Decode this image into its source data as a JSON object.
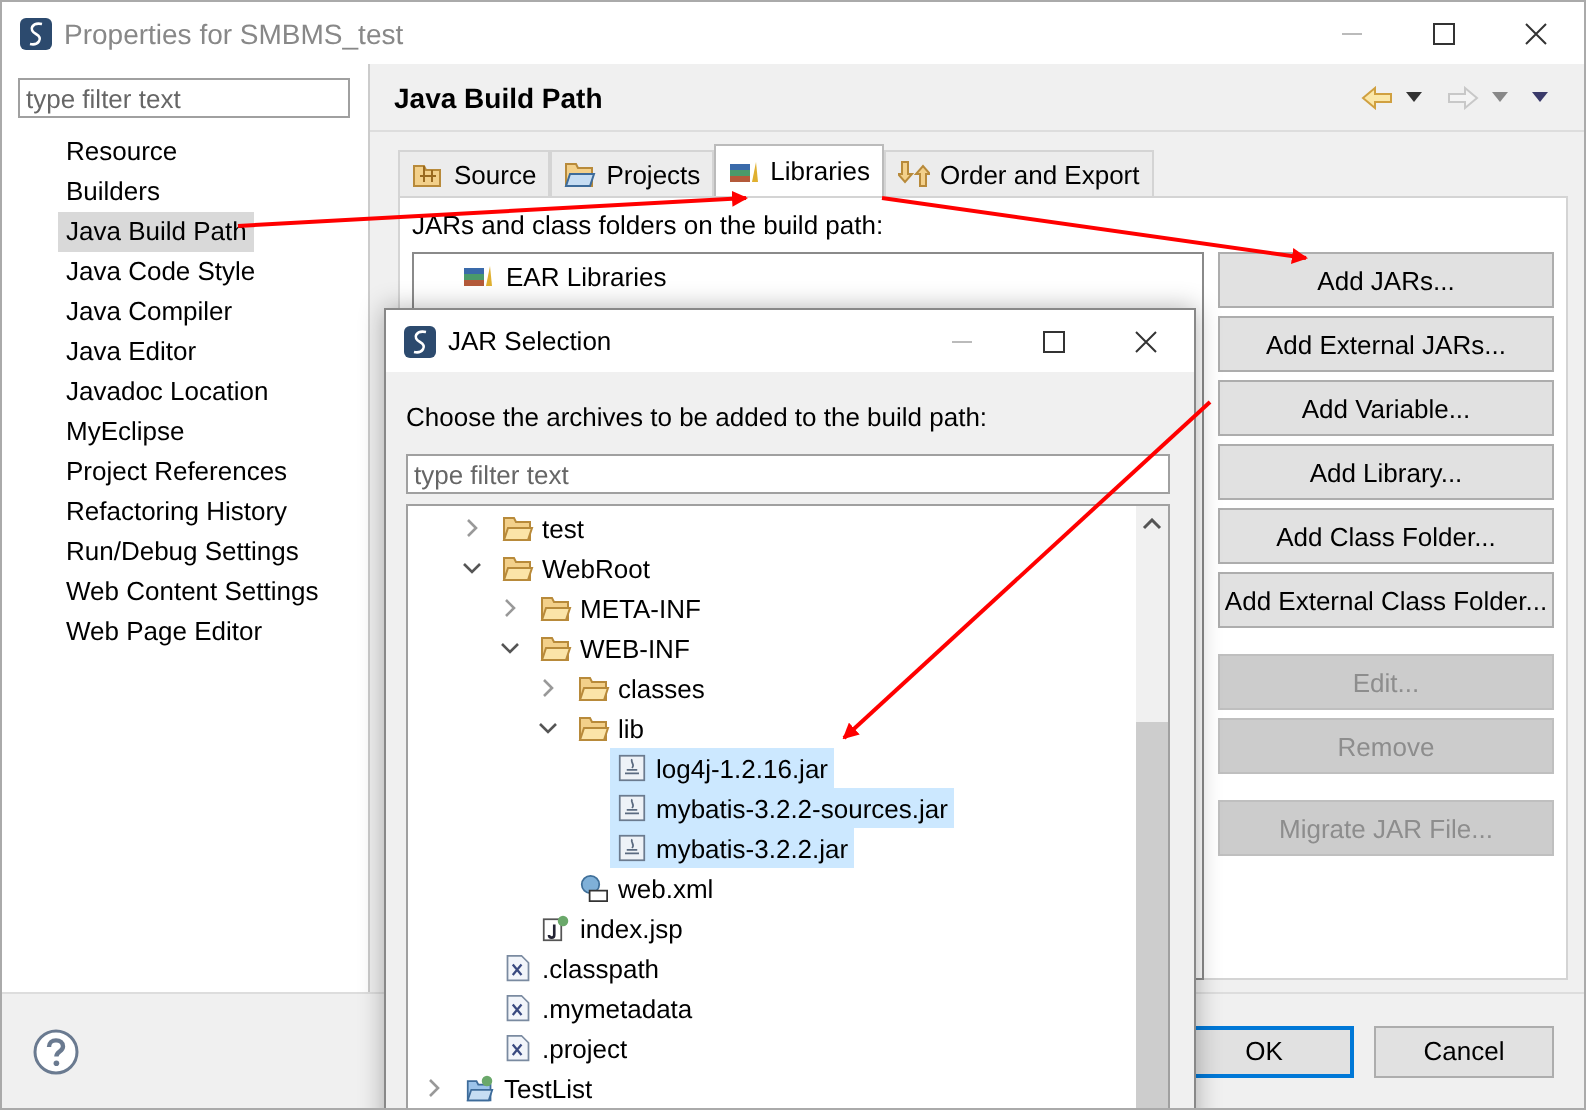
{
  "window": {
    "title": "Properties for SMBMS_test"
  },
  "sidebar": {
    "filter_placeholder": "type filter text",
    "items": [
      {
        "label": "Resource",
        "selected": false
      },
      {
        "label": "Builders",
        "selected": false
      },
      {
        "label": "Java Build Path",
        "selected": true
      },
      {
        "label": "Java Code Style",
        "selected": false
      },
      {
        "label": "Java Compiler",
        "selected": false
      },
      {
        "label": "Java Editor",
        "selected": false
      },
      {
        "label": "Javadoc Location",
        "selected": false
      },
      {
        "label": "MyEclipse",
        "selected": false
      },
      {
        "label": "Project References",
        "selected": false
      },
      {
        "label": "Refactoring History",
        "selected": false
      },
      {
        "label": "Run/Debug Settings",
        "selected": false
      },
      {
        "label": "Web Content Settings",
        "selected": false
      },
      {
        "label": "Web Page Editor",
        "selected": false
      }
    ]
  },
  "page": {
    "title": "Java Build Path",
    "tabs": [
      {
        "label": "Source",
        "kind": "source",
        "selected": false
      },
      {
        "label": "Projects",
        "kind": "projects",
        "selected": false
      },
      {
        "label": "Libraries",
        "kind": "libraries",
        "selected": true
      },
      {
        "label": "Order and Export",
        "kind": "order",
        "selected": false
      }
    ],
    "description": "JARs and class folders on the build path:",
    "libraries": [
      "EAR Libraries"
    ],
    "button_groups": [
      [
        {
          "label": "Add JARs...",
          "disabled": false
        },
        {
          "label": "Add External JARs...",
          "disabled": false
        },
        {
          "label": "Add Variable...",
          "disabled": false
        },
        {
          "label": "Add Library...",
          "disabled": false
        },
        {
          "label": "Add Class Folder...",
          "disabled": false
        },
        {
          "label": "Add External Class Folder...",
          "disabled": false
        }
      ],
      [
        {
          "label": "Edit...",
          "disabled": true
        },
        {
          "label": "Remove",
          "disabled": true
        }
      ],
      [
        {
          "label": "Migrate JAR File...",
          "disabled": true
        }
      ]
    ]
  },
  "footer": {
    "buttons": [
      {
        "label": "OK",
        "default": true
      },
      {
        "label": "Cancel",
        "default": false
      }
    ]
  },
  "dialog": {
    "title": "JAR Selection",
    "description": "Choose the archives to be added to the build path:",
    "filter_placeholder": "type filter text",
    "tree": {
      "open_branch": [
        {
          "label": "test",
          "kind": "folder",
          "expanded": false,
          "selected": false
        },
        {
          "label": "WebRoot",
          "kind": "folder",
          "expanded": true,
          "selected": false,
          "children": [
            {
              "label": "META-INF",
              "kind": "folder",
              "expanded": false,
              "selected": false
            },
            {
              "label": "WEB-INF",
              "kind": "folder",
              "expanded": true,
              "selected": false,
              "children": [
                {
                  "label": "classes",
                  "kind": "folder",
                  "expanded": false,
                  "selected": false
                },
                {
                  "label": "lib",
                  "kind": "folder",
                  "expanded": true,
                  "selected": false,
                  "children": [
                    {
                      "label": "log4j-1.2.16.jar",
                      "kind": "jar",
                      "selected": true
                    },
                    {
                      "label": "mybatis-3.2.2-sources.jar",
                      "kind": "jar",
                      "selected": true
                    },
                    {
                      "label": "mybatis-3.2.2.jar",
                      "kind": "jar",
                      "selected": true
                    }
                  ]
                },
                {
                  "label": "web.xml",
                  "kind": "webxml",
                  "selected": false
                }
              ]
            },
            {
              "label": "index.jsp",
              "kind": "jsp",
              "selected": false
            }
          ]
        },
        {
          "label": ".classpath",
          "kind": "xfile",
          "selected": false
        },
        {
          "label": ".mymetadata",
          "kind": "xfile",
          "selected": false
        },
        {
          "label": ".project",
          "kind": "xfile",
          "selected": false
        }
      ],
      "items": [
        {
          "label": "TestList",
          "kind": "project",
          "expanded": false,
          "selected": false
        }
      ]
    }
  }
}
